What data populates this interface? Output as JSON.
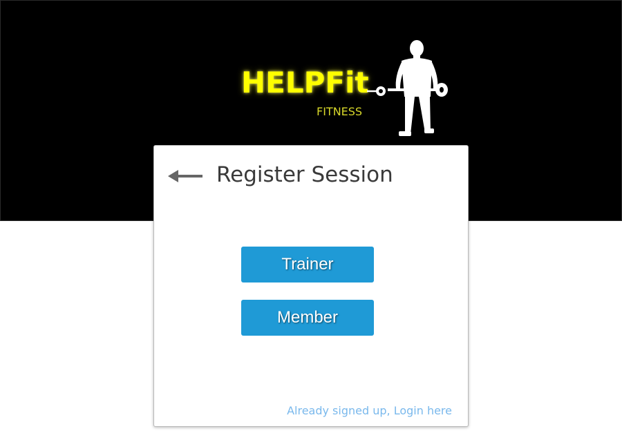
{
  "brand": {
    "name": "HELPFit",
    "tagline": "FITNESS",
    "colors": {
      "name": "#ffff00",
      "tagline": "#d7d72a",
      "header_background": "#000000"
    },
    "figure_icon": "weightlifter-icon"
  },
  "card": {
    "back_icon": "left-arrow-icon",
    "title": "Register Session",
    "buttons": {
      "trainer": "Trainer",
      "member": "Member"
    },
    "login_link": "Already signed up, Login here"
  },
  "colors": {
    "button": "#1f9ad6",
    "link": "#79b8ec",
    "title": "#3a3a3a"
  }
}
